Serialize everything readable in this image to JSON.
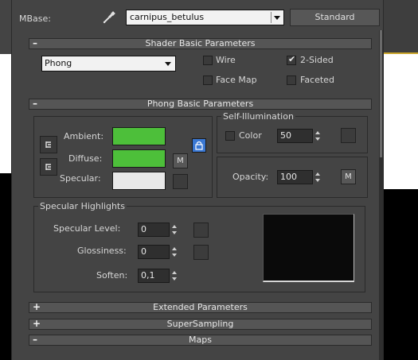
{
  "toolbar": {
    "mbase_label": "MBase:",
    "material_name": "carnipus_betulus",
    "standard_label": "Standard"
  },
  "rollouts": {
    "shader_basic": {
      "sign": "–",
      "title": "Shader Basic Parameters"
    },
    "phong_basic": {
      "sign": "–",
      "title": "Phong Basic Parameters"
    },
    "extended": {
      "sign": "+",
      "title": "Extended Parameters"
    },
    "supersampling": {
      "sign": "+",
      "title": "SuperSampling"
    },
    "maps": {
      "sign": "–",
      "title": "Maps"
    }
  },
  "shader": {
    "selected": "Phong",
    "wire": {
      "label": "Wire",
      "checked": false
    },
    "two_sided": {
      "label": "2-Sided",
      "checked": true
    },
    "face_map": {
      "label": "Face Map",
      "checked": false
    },
    "faceted": {
      "label": "Faceted",
      "checked": false
    }
  },
  "phong": {
    "ambient_label": "Ambient:",
    "diffuse_label": "Diffuse:",
    "specular_label": "Specular:",
    "ambient_color": "#4dbf3a",
    "diffuse_color": "#4dbf3a",
    "specular_color": "#e8e8e8",
    "m_label": "M",
    "lock_color": "#3a78d4"
  },
  "self_illum": {
    "title": "Self-Illumination",
    "color_label": "Color",
    "value": "50"
  },
  "opacity": {
    "label": "Opacity:",
    "value": "100",
    "m_label": "M"
  },
  "specular_highlights": {
    "title": "Specular Highlights",
    "level_label": "Specular Level:",
    "level_value": "0",
    "gloss_label": "Glossiness:",
    "gloss_value": "0",
    "soften_label": "Soften:",
    "soften_value": "0,1"
  }
}
